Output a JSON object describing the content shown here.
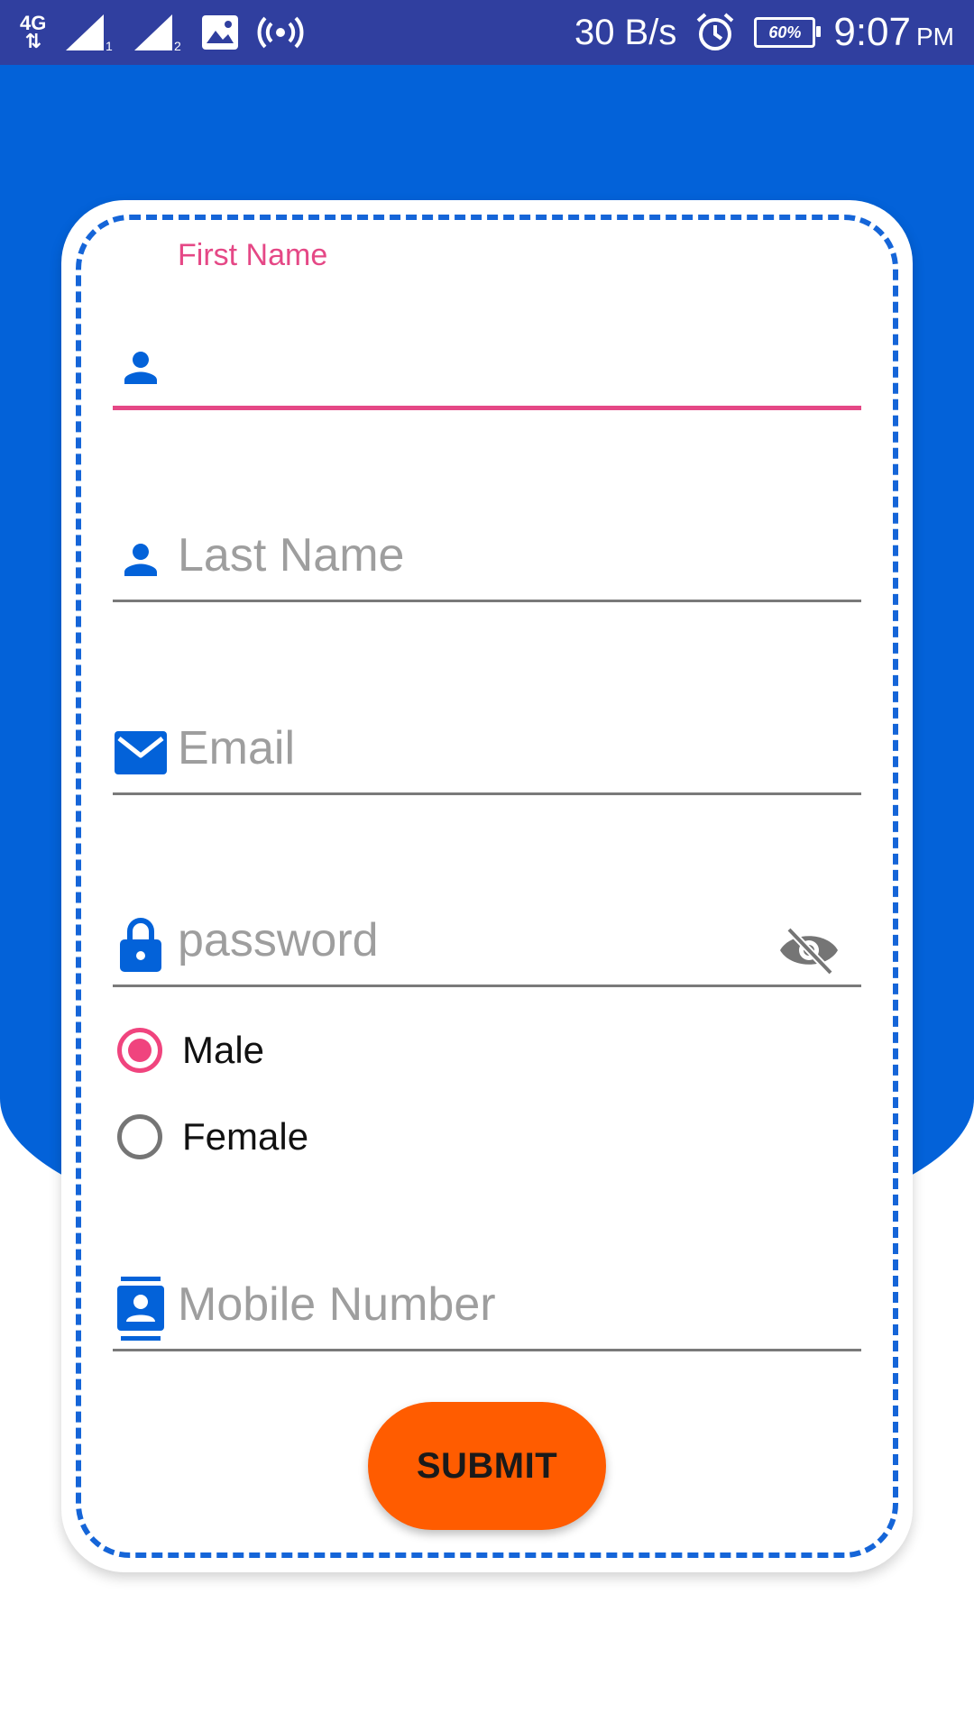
{
  "status_bar": {
    "network_type": "4G",
    "sim1_label": "1",
    "sim2_label": "2",
    "speed": "30 B/s",
    "battery": "60%",
    "time": "9:07",
    "ampm": "PM",
    "icons": [
      "4g-data-icon",
      "signal-sim1-icon",
      "signal-sim2-icon",
      "image-notification-icon",
      "hotspot-icon",
      "alarm-icon",
      "battery-icon"
    ]
  },
  "form": {
    "first_name": {
      "label": "First Name",
      "value": "",
      "icon": "person-icon"
    },
    "last_name": {
      "placeholder": "Last Name",
      "icon": "person-icon"
    },
    "email": {
      "placeholder": "Email",
      "icon": "mail-icon"
    },
    "password": {
      "placeholder": "password",
      "icon": "lock-icon",
      "toggle_icon": "visibility-off-icon"
    },
    "gender": {
      "options": [
        "Male",
        "Female"
      ],
      "selected": "Male"
    },
    "mobile": {
      "placeholder": "Mobile Number",
      "icon": "contact-icon"
    },
    "submit_label": "SUBMIT"
  },
  "colors": {
    "primary_blue": "#0362D9",
    "accent_pink": "#E54886",
    "submit_orange": "#FF5C00",
    "status_bar": "#303F9F"
  }
}
